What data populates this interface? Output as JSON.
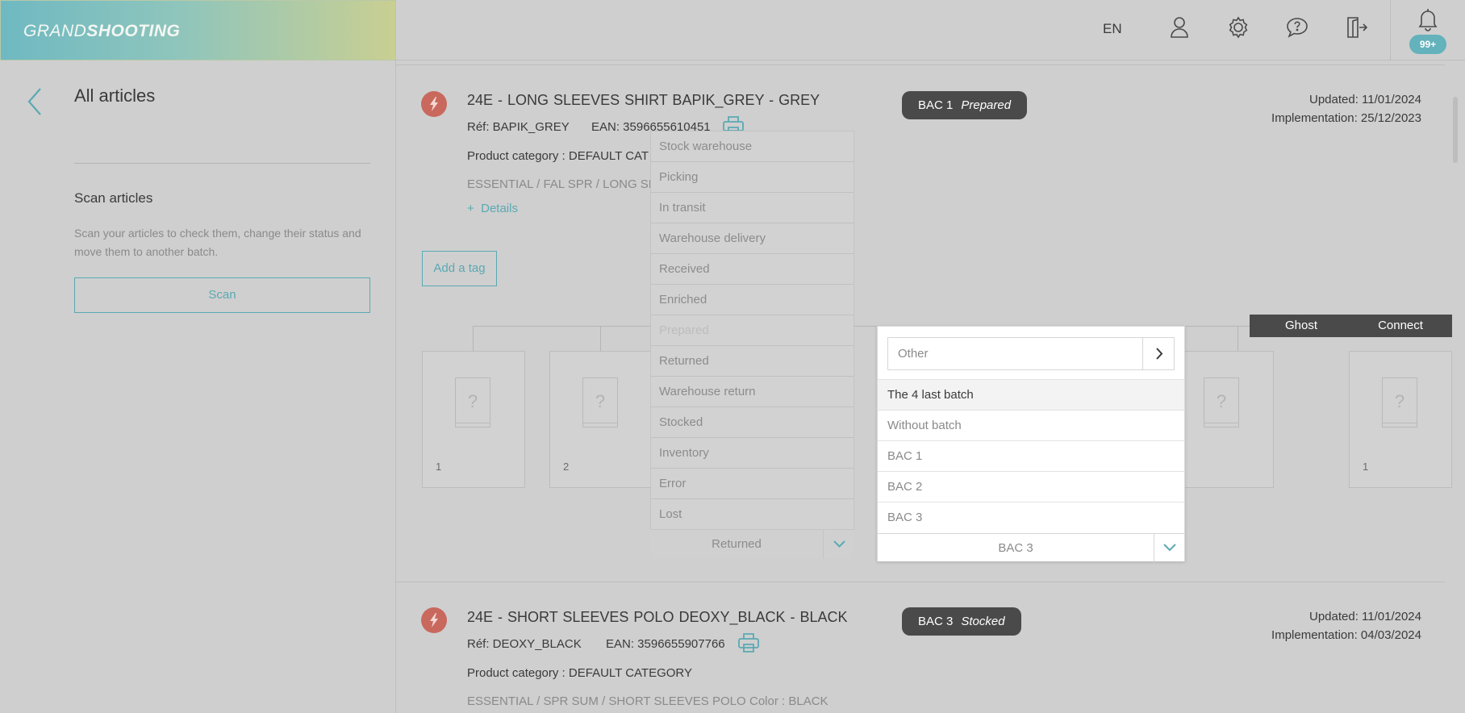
{
  "app": {
    "logo_part1": "GRAND",
    "logo_part2": "SHOOTING"
  },
  "topbar": {
    "language": "EN",
    "notifications_count": "99+",
    "icons": [
      "user-icon",
      "settings-gear-icon",
      "help-bubble-icon",
      "logout-door-icon",
      "bell-icon"
    ]
  },
  "sidebar": {
    "title": "All articles",
    "scan_title": "Scan articles",
    "scan_description": "Scan your articles to check them, change their status and move them to another batch.",
    "scan_button": "Scan"
  },
  "articles": [
    {
      "title": "24E  -  LONG SLEEVES SHIRT BAPIK_GREY  -  GREY",
      "ref": "Réf: BAPIK_GREY",
      "ean": "EAN: 3596655610451",
      "category": "Product category : DEFAULT CAT",
      "path": "ESSENTIAL / FAL SPR / LONG SL",
      "details": "Details",
      "batch": "BAC 1",
      "status": "Prepared",
      "updated": "Updated: 11/01/2024",
      "implementation": "Implementation: 25/12/2023"
    },
    {
      "title": "24E  -  SHORT SLEEVES POLO DEOXY_BLACK  -  BLACK",
      "ref": "Réf: DEOXY_BLACK",
      "ean": "EAN: 3596655907766",
      "category": "Product category : DEFAULT CATEGORY",
      "path": "ESSENTIAL / SPR SUM / SHORT SLEEVES POLO",
      "color": "Color : BLACK",
      "batch": "BAC 3",
      "status": "Stocked",
      "updated": "Updated: 11/01/2024",
      "implementation": "Implementation: 04/03/2024"
    }
  ],
  "add_tag": "Add a tag",
  "cards": [
    {
      "placeholder": "?",
      "number": "1"
    },
    {
      "placeholder": "?",
      "number": "2"
    },
    {
      "placeholder": "?",
      "number": ""
    },
    {
      "placeholder": "?",
      "number": "1"
    }
  ],
  "tabs": {
    "ghost": "Ghost",
    "connect": "Connect"
  },
  "status_dropdown": {
    "options": [
      "Stock warehouse",
      "Picking",
      "In transit",
      "Warehouse delivery",
      "Received",
      "Enriched",
      "Prepared",
      "Returned",
      "Warehouse return",
      "Stocked",
      "Inventory",
      "Error",
      "Lost"
    ],
    "disabled_option": "Prepared",
    "selected": "Returned"
  },
  "batch_dropdown": {
    "other_placeholder": "Other",
    "group_header": "The 4 last batch",
    "options": [
      "Without batch",
      "BAC 1",
      "BAC 2",
      "BAC 3"
    ],
    "selected": "BAC 3"
  },
  "colors": {
    "accent": "#5aa9b3",
    "bolt": "#c9685d",
    "pill": "#4a4a4a"
  }
}
